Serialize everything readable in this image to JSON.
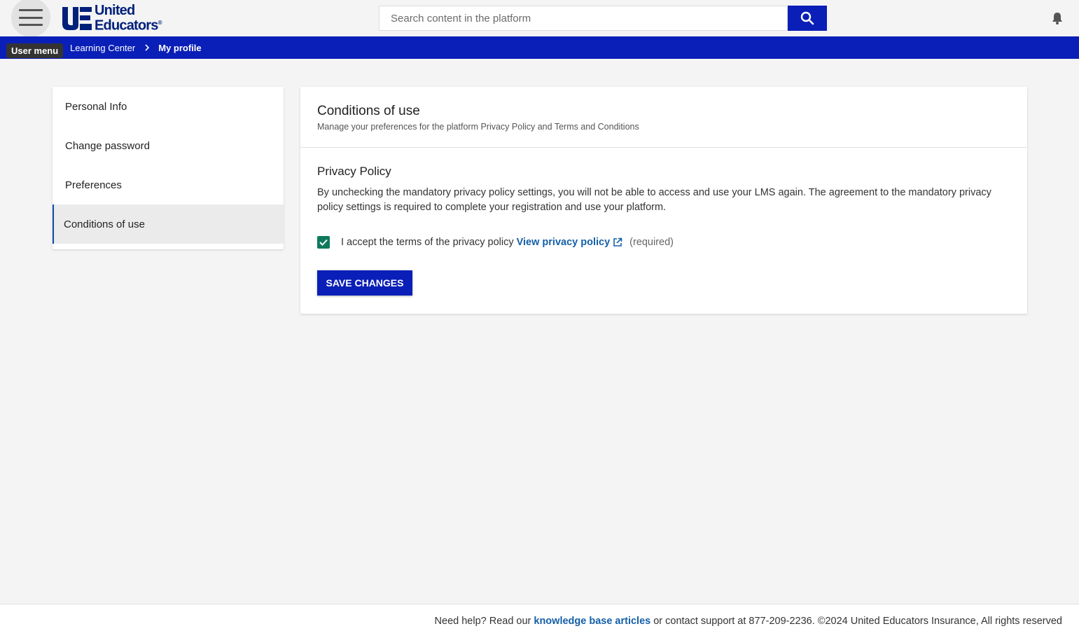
{
  "header": {
    "menu_tooltip": "User menu",
    "logo_line1": "United",
    "logo_line2": "Educators",
    "logo_mark": "®",
    "search_placeholder": "Search content in the platform"
  },
  "breadcrumb": {
    "items": [
      "Learning Center",
      "My profile"
    ]
  },
  "sidebar": {
    "items": [
      {
        "label": "Personal Info"
      },
      {
        "label": "Change password"
      },
      {
        "label": "Preferences"
      },
      {
        "label": "Conditions of use"
      }
    ],
    "active_index": 3
  },
  "main": {
    "title": "Conditions of use",
    "subtitle": "Manage your preferences for the platform Privacy Policy and Terms and Conditions",
    "section_title": "Privacy Policy",
    "section_desc": "By unchecking the mandatory privacy policy settings, you will not be able to access and use your LMS again. The agreement to the mandatory privacy policy settings is required to complete your registration and use your platform.",
    "checkbox_checked": true,
    "checkbox_label": "I accept the terms of the privacy policy",
    "link_label": "View privacy policy",
    "required_label": "(required)",
    "save_label": "SAVE CHANGES"
  },
  "footer": {
    "text_before": "Need help? Read our",
    "link": "knowledge base articles",
    "text_after": "or contact support at 877-209-2236. ©2024 United Educators Insurance, All rights reserved"
  },
  "colors": {
    "brand_blue": "#0a1fb8",
    "checkbox_green": "#0e7a5c",
    "link_blue": "#1560a8"
  },
  "icons": {
    "menu": "hamburger-icon",
    "search": "search-icon",
    "notifications": "bell-icon",
    "breadcrumb_separator": "chevron-right-icon",
    "external_link": "external-link-icon",
    "checkbox": "checkmark-icon"
  }
}
